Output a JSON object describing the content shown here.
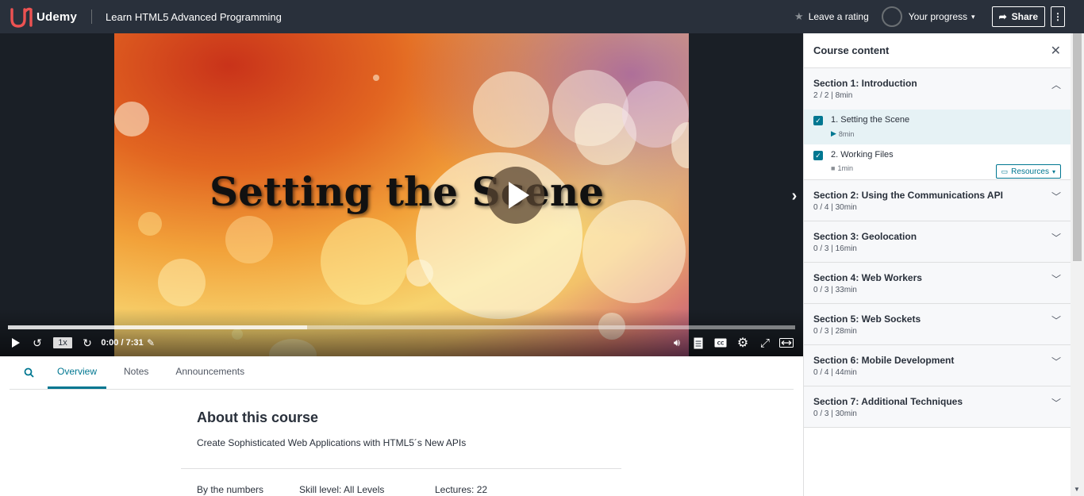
{
  "header": {
    "logo_text": "Udemy",
    "course_title": "Learn HTML5 Advanced Programming",
    "leave_rating": "Leave a rating",
    "your_progress": "Your progress",
    "share": "Share",
    "more": "⋮"
  },
  "player": {
    "video_title": "Setting the Scene",
    "speed": "1x",
    "time": "0:00 / 7:31",
    "progress_fraction": 0.38
  },
  "tabs": {
    "items": [
      "Overview",
      "Notes",
      "Announcements"
    ],
    "active": "Overview"
  },
  "about": {
    "title": "About this course",
    "subtitle": "Create Sophisticated Web Applications with HTML5´s New APIs",
    "by_numbers": "By the numbers",
    "skill_level": "Skill level: All Levels",
    "lectures": "Lectures: 22"
  },
  "sidebar": {
    "title": "Course content",
    "sections": [
      {
        "title": "Section 1: Introduction",
        "meta": "2 / 2 | 8min",
        "open": true
      },
      {
        "title": "Section 2: Using the Communications API",
        "meta": "0 / 4 | 30min"
      },
      {
        "title": "Section 3: Geolocation",
        "meta": "0 / 3 | 16min"
      },
      {
        "title": "Section 4: Web Workers",
        "meta": "0 / 3 | 33min"
      },
      {
        "title": "Section 5: Web Sockets",
        "meta": "0 / 3 | 28min"
      },
      {
        "title": "Section 6: Mobile Development",
        "meta": "0 / 4 | 44min"
      },
      {
        "title": "Section 7: Additional Techniques",
        "meta": "0 / 3 | 30min"
      }
    ],
    "lectures": [
      {
        "title": "1. Setting the Scene",
        "duration": "8min",
        "current": true
      },
      {
        "title": "2. Working Files",
        "duration": "1min",
        "resources": "Resources"
      }
    ]
  },
  "colors": {
    "topbar": "#29303b",
    "accent": "#007791",
    "brand": "#ec5252"
  }
}
